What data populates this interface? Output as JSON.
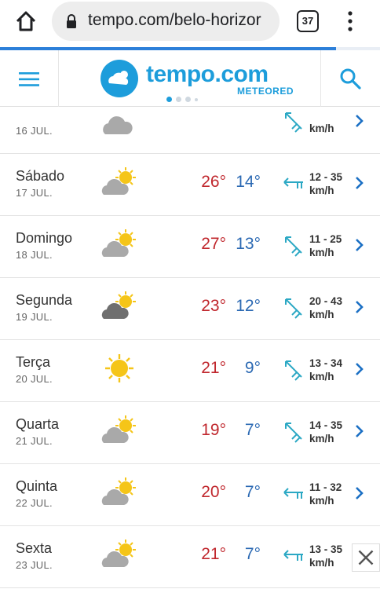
{
  "browser": {
    "url": "tempo.com/belo-horizor",
    "tab_count": "37"
  },
  "header": {
    "logo_text": "tempo.com",
    "logo_sub": "METEORED"
  },
  "colors": {
    "brand": "#1d9ddb",
    "max_temp": "#c0272d",
    "min_temp": "#2b69b3"
  },
  "forecast": [
    {
      "day": "",
      "date": "16 JUL.",
      "icon": "cloud-icon",
      "max": "",
      "min": "",
      "wind": "",
      "unit": "km/h",
      "arrow": "wind-arrow-diagonal-icon"
    },
    {
      "day": "Sábado",
      "date": "17 JUL.",
      "icon": "sun-behind-cloud-icon",
      "max": "26°",
      "min": "14°",
      "wind": "12 - 35",
      "unit": "km/h",
      "arrow": "wind-arrow-west-icon"
    },
    {
      "day": "Domingo",
      "date": "18 JUL.",
      "icon": "sun-behind-cloud-icon",
      "max": "27°",
      "min": "13°",
      "wind": "11 - 25",
      "unit": "km/h",
      "arrow": "wind-arrow-diagonal-icon"
    },
    {
      "day": "Segunda",
      "date": "19 JUL.",
      "icon": "sun-behind-dark-cloud-icon",
      "max": "23°",
      "min": "12°",
      "wind": "20 - 43",
      "unit": "km/h",
      "arrow": "wind-arrow-diagonal-icon"
    },
    {
      "day": "Terça",
      "date": "20 JUL.",
      "icon": "sun-icon",
      "max": "21°",
      "min": "9°",
      "wind": "13 - 34",
      "unit": "km/h",
      "arrow": "wind-arrow-diagonal-icon"
    },
    {
      "day": "Quarta",
      "date": "21 JUL.",
      "icon": "sun-behind-cloud-icon",
      "max": "19°",
      "min": "7°",
      "wind": "14 - 35",
      "unit": "km/h",
      "arrow": "wind-arrow-diagonal-icon"
    },
    {
      "day": "Quinta",
      "date": "22 JUL.",
      "icon": "sun-behind-cloud-icon",
      "max": "20°",
      "min": "7°",
      "wind": "11 - 32",
      "unit": "km/h",
      "arrow": "wind-arrow-west-icon"
    },
    {
      "day": "Sexta",
      "date": "23 JUL.",
      "icon": "sun-behind-cloud-icon",
      "max": "21°",
      "min": "7°",
      "wind": "13 - 35",
      "unit": "km/h",
      "arrow": "wind-arrow-west-icon"
    }
  ]
}
